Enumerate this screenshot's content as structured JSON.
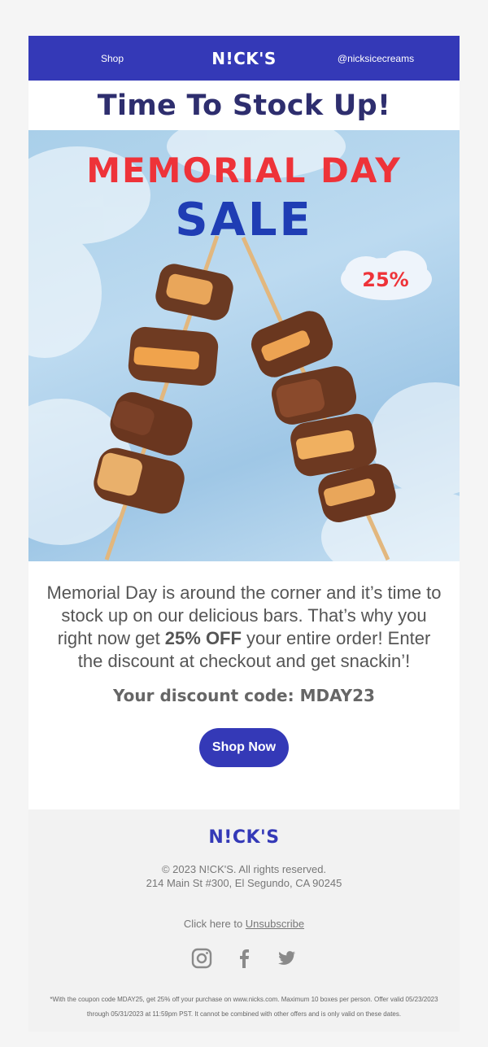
{
  "nav": {
    "shop_label": "Shop",
    "logo": "N!CK'S",
    "handle": "@nicksicecreams"
  },
  "headline": "Time To Stock Up!",
  "hero": {
    "title_line1": "MEMORIAL DAY",
    "title_line2": "SALE",
    "badge": "25%",
    "image_icon": "candy-bar-skewers-icon"
  },
  "body": {
    "text_before": "Memorial Day is around the corner and it’s time to stock up on our delicious bars. That’s why you right now get ",
    "text_bold": "25% OFF",
    "text_after": " your entire order! Enter the discount at checkout and get snackin’!"
  },
  "discount_line": "Your discount code: MDAY23",
  "cta_label": "Shop Now",
  "footer": {
    "logo": "N!CK'S",
    "copyright": "© 2023 N!CK'S. All rights reserved.",
    "address": "214 Main St #300, El Segundo, CA 90245",
    "unsub_prefix": "Click here to ",
    "unsub_link": "Unsubscribe",
    "social_icons": [
      "instagram-icon",
      "facebook-icon",
      "twitter-icon"
    ],
    "fine_print": "*With the coupon code MDAY25, get 25% off your purchase on www.nicks.com. Maximum 10 boxes per person. Offer valid 05/23/2023 through 05/31/2023 at 11:59pm PST. It cannot be combined with other offers and is only valid on these dates."
  },
  "colors": {
    "brand_blue": "#3439b7",
    "headline_navy": "#2e2e6e",
    "sale_red": "#ee3339",
    "sale_blue": "#1f3db4"
  }
}
